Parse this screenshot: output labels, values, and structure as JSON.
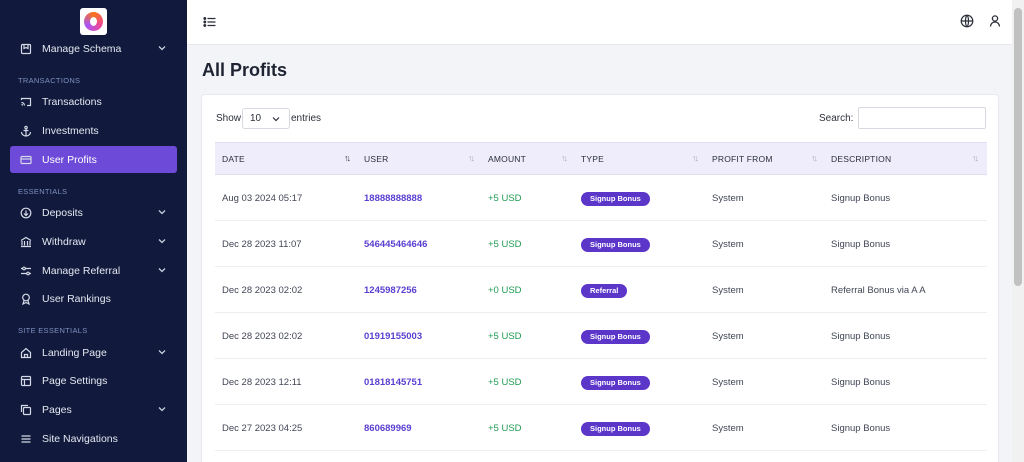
{
  "sidebar": {
    "items": [
      {
        "label": "Manage Schema",
        "icon": "schema-icon",
        "chevron": true,
        "active": false
      },
      {
        "label": "Transactions",
        "icon": "cast-icon",
        "chevron": false,
        "active": false
      },
      {
        "label": "Investments",
        "icon": "anchor-icon",
        "chevron": false,
        "active": false
      },
      {
        "label": "User Profits",
        "icon": "credit-card-icon",
        "chevron": false,
        "active": true
      },
      {
        "label": "Deposits",
        "icon": "arrow-down-circle-icon",
        "chevron": true,
        "active": false
      },
      {
        "label": "Withdraw",
        "icon": "bank-icon",
        "chevron": true,
        "active": false
      },
      {
        "label": "Manage Referral",
        "icon": "sliders-icon",
        "chevron": true,
        "active": false
      },
      {
        "label": "User Rankings",
        "icon": "award-icon",
        "chevron": false,
        "active": false
      },
      {
        "label": "Landing Page",
        "icon": "home-icon",
        "chevron": true,
        "active": false
      },
      {
        "label": "Page Settings",
        "icon": "layout-icon",
        "chevron": false,
        "active": false
      },
      {
        "label": "Pages",
        "icon": "copy-icon",
        "chevron": true,
        "active": false
      },
      {
        "label": "Site Navigations",
        "icon": "menu-icon",
        "chevron": false,
        "active": false
      }
    ],
    "sections": [
      "TRANSACTIONS",
      "ESSENTIALS",
      "SITE ESSENTIALS"
    ]
  },
  "page": {
    "title": "All Profits"
  },
  "controls": {
    "show_label": "Show",
    "entries_value": "10",
    "entries_label": "entries",
    "search_label": "Search:",
    "search_value": ""
  },
  "table": {
    "headers": [
      "DATE",
      "USER",
      "AMOUNT",
      "TYPE",
      "PROFIT FROM",
      "DESCRIPTION"
    ],
    "sort_indicator": "↑↓",
    "rows": [
      {
        "date": "Aug 03 2024 05:17",
        "user": "18888888888",
        "amount": "+5 USD",
        "type": "Signup Bonus",
        "profit_from": "System",
        "description": "Signup Bonus"
      },
      {
        "date": "Dec 28 2023 11:07",
        "user": "546445464646",
        "amount": "+5 USD",
        "type": "Signup Bonus",
        "profit_from": "System",
        "description": "Signup Bonus"
      },
      {
        "date": "Dec 28 2023 02:02",
        "user": "1245987256",
        "amount": "+0 USD",
        "type": "Referral",
        "profit_from": "System",
        "description": "Referral Bonus via A A"
      },
      {
        "date": "Dec 28 2023 02:02",
        "user": "01919155003",
        "amount": "+5 USD",
        "type": "Signup Bonus",
        "profit_from": "System",
        "description": "Signup Bonus"
      },
      {
        "date": "Dec 28 2023 12:11",
        "user": "01818145751",
        "amount": "+5 USD",
        "type": "Signup Bonus",
        "profit_from": "System",
        "description": "Signup Bonus"
      },
      {
        "date": "Dec 27 2023 04:25",
        "user": "860689969",
        "amount": "+5 USD",
        "type": "Signup Bonus",
        "profit_from": "System",
        "description": "Signup Bonus"
      }
    ]
  },
  "colors": {
    "sidebar_bg": "#111a3c",
    "accent": "#6d4bd8",
    "badge": "#5b36c9",
    "amount": "#1f9a52",
    "user_link": "#5b3fd0"
  }
}
